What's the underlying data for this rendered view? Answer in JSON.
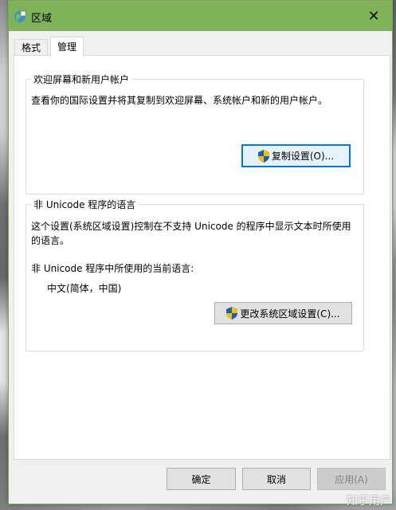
{
  "window": {
    "title": "区域",
    "close_glyph": "✕"
  },
  "tabs": [
    {
      "label": "格式",
      "active": false
    },
    {
      "label": "管理",
      "active": true
    }
  ],
  "welcome_group": {
    "title": "欢迎屏幕和新用户帐户",
    "description": "查看你的国际设置并将其复制到欢迎屏幕、系统帐户和新的用户帐户。",
    "button_label": "复制设置(O)...",
    "button_icon": "uac-shield-icon"
  },
  "unicode_group": {
    "title": "非 Unicode 程序的语言",
    "description": "这个设置(系统区域设置)控制在不支持 Unicode 的程序中显示文本时所使用的语言。",
    "current_label": "非 Unicode 程序中所使用的当前语言:",
    "current_value": "中文(简体，中国)",
    "button_label": "更改系统区域设置(C)...",
    "button_icon": "uac-shield-icon"
  },
  "footer": {
    "ok_label": "确定",
    "cancel_label": "取消",
    "apply_label": "应用(A)",
    "apply_enabled": false
  },
  "watermark": "知乎用户",
  "colors": {
    "titlebar": "#7fb25a",
    "focus_border": "#0078d7"
  }
}
